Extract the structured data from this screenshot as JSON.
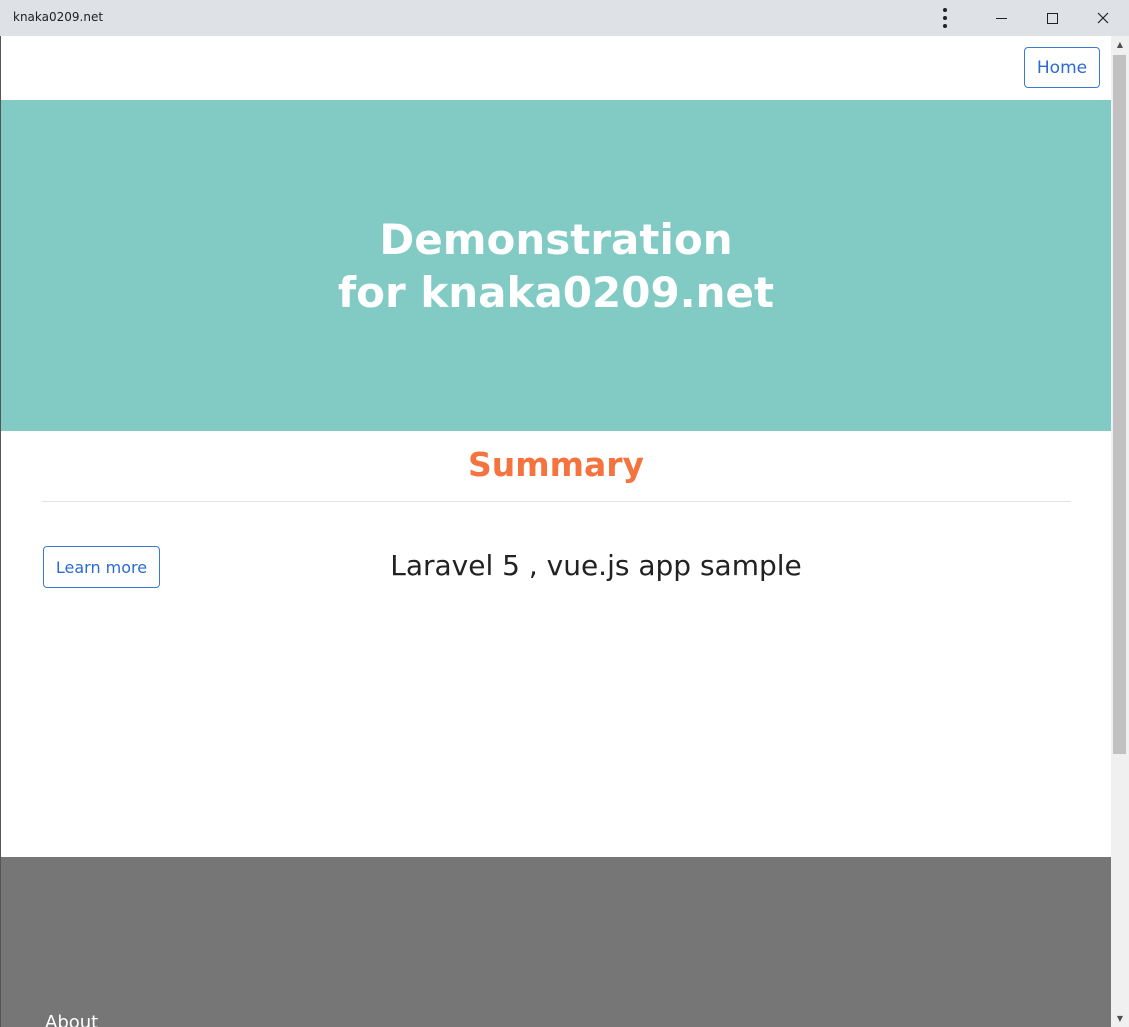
{
  "window": {
    "title": "knaka0209.net"
  },
  "nav": {
    "home_label": "Home"
  },
  "hero": {
    "line1": "Demonstration",
    "line2": "for knaka0209.net"
  },
  "summary": {
    "heading": "Summary",
    "learn_more_label": "Learn more",
    "app_title": "Laravel 5 , vue.js app sample"
  },
  "footer": {
    "about_label": "About"
  },
  "colors": {
    "hero_bg": "#81cbc4",
    "summary_accent": "#f4733e",
    "button_border": "#3a7bd5",
    "footer_bg": "#767676"
  },
  "icons": {
    "menu": "kebab-menu-icon",
    "minimize": "minimize-icon",
    "maximize": "maximize-icon",
    "close": "close-icon"
  }
}
